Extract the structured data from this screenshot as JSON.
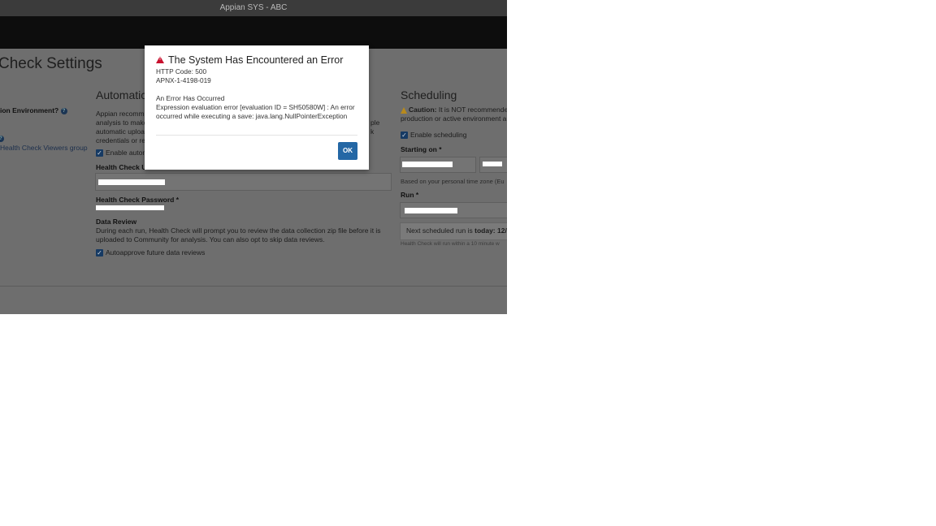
{
  "window": {
    "title": "Appian SYS - ABC"
  },
  "page": {
    "title": "Check Settings"
  },
  "left_panel": {
    "env_question": "ion Environment?",
    "viewers_link": "Health Check Viewers group"
  },
  "automation": {
    "heading": "Automatic",
    "desc_lines": [
      "Appian recomm",
      "analysis to make",
      "automatic uploa",
      "credentials or re"
    ],
    "desc_right_lines": [
      "ple",
      "k"
    ],
    "enable_label": "Enable autom",
    "username_label": "Health Check U",
    "password_label": "Health Check Password *"
  },
  "data_review": {
    "heading": "Data Review",
    "desc": "During each run, Health Check will prompt you to review the data collection zip file before it is uploaded to Community for analysis. You can also opt to skip data reviews.",
    "autoapprove_label": "Autoapprove future data reviews"
  },
  "scheduling": {
    "heading": "Scheduling",
    "caution_label": "Caution:",
    "caution_text": "It is NOT recommende",
    "caution_text2": "production or active environment a",
    "enable_label": "Enable scheduling",
    "starting_label": "Starting on *",
    "timezone_note": "Based on your personal time zone (Eu",
    "run_label": "Run *",
    "next_run_prefix": "Next scheduled run is",
    "next_run_value": "today: 12/",
    "run_window_note": "Health Check will run within a 10 minute w"
  },
  "error_dialog": {
    "title": "The System Has Encountered an Error",
    "http_code": "HTTP Code: 500",
    "error_id": "APNX-1-4198-019",
    "heading": "An Error Has Occurred",
    "message": "Expression evaluation error [evaluation ID = SH50580W] : An error occurred while executing a save: java.lang.NullPointerException",
    "ok_label": "OK"
  },
  "colors": {
    "ok_button": "#2467a5",
    "error_icon": "#c8102e",
    "overlay_background": "#6e6e6e"
  }
}
